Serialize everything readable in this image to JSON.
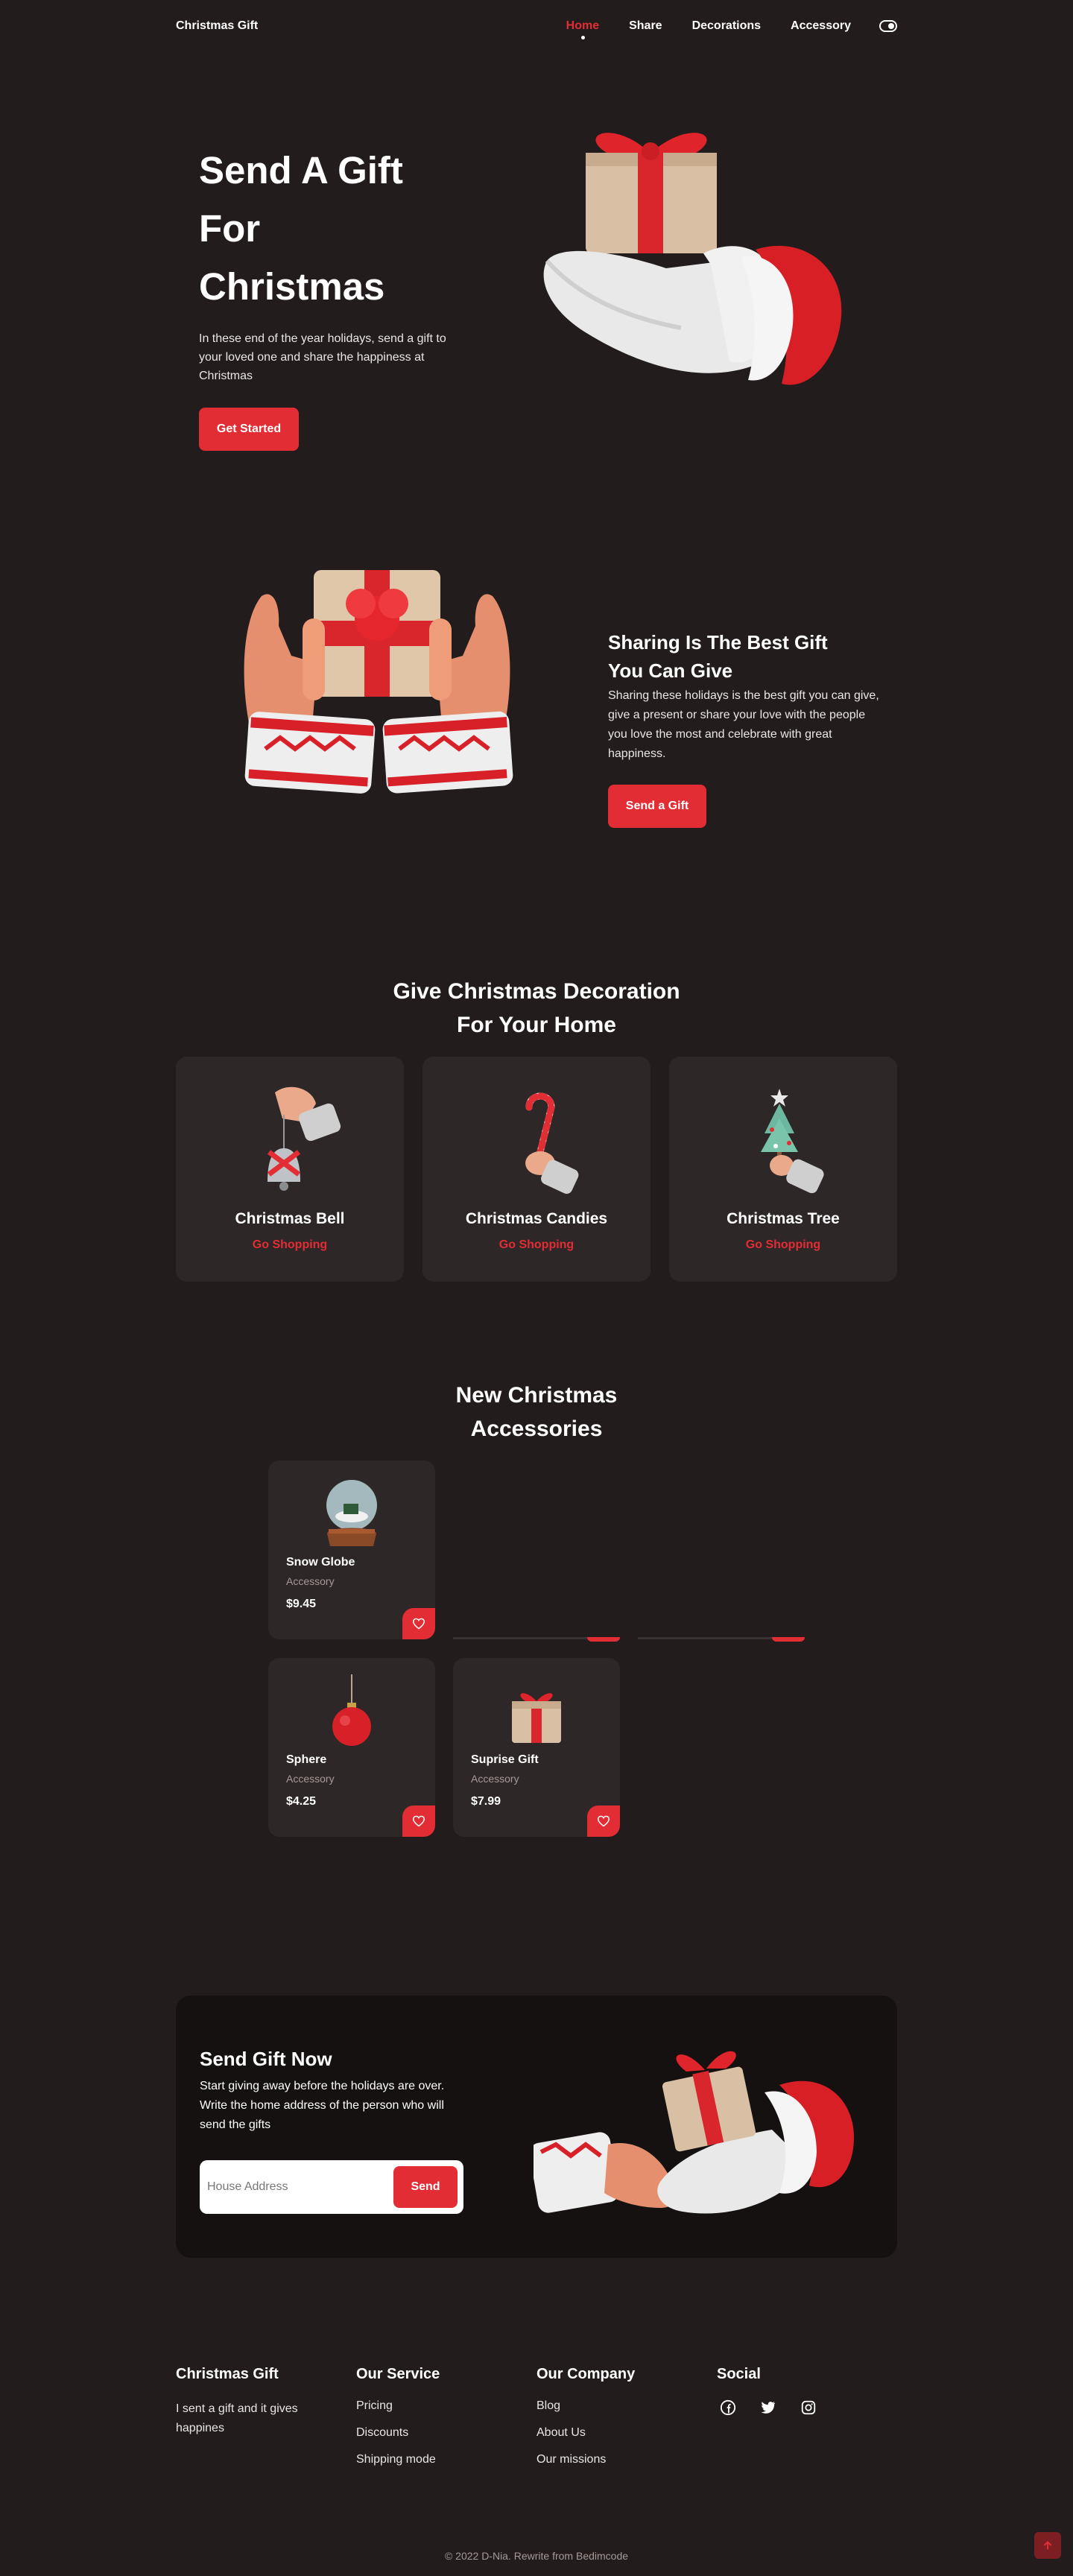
{
  "nav": {
    "logo": "Christmas Gift",
    "links": [
      "Home",
      "Share",
      "Decorations",
      "Accessory"
    ]
  },
  "hero": {
    "title_line1": "Send A Gift For",
    "title_line2": "Christmas",
    "description": "In these end of the year holidays, send a gift to your loved one and share the happiness at Christmas",
    "cta": "Get Started"
  },
  "share": {
    "title_line1": "Sharing Is The Best Gift",
    "title_line2": "You Can Give",
    "description": "Sharing these holidays is the best gift you can give, give a present or share your love with the people you love the most and celebrate with great happiness.",
    "cta": "Send a Gift"
  },
  "decorations": {
    "title_line1": "Give Christmas Decoration",
    "title_line2": "For Your Home",
    "items": [
      {
        "name": "Christmas Bell",
        "link": "Go Shopping"
      },
      {
        "name": "Christmas Candies",
        "link": "Go Shopping"
      },
      {
        "name": "Christmas Tree",
        "link": "Go Shopping"
      }
    ]
  },
  "accessories": {
    "title_line1": "New Christmas",
    "title_line2": "Accessories",
    "items": [
      {
        "name": "Snow Globe",
        "category": "Accessory",
        "price": "$9.45"
      },
      {
        "name": "Sphere",
        "category": "Accessory",
        "price": "$4.25"
      },
      {
        "name": "Suprise Gift",
        "category": "Accessory",
        "price": "$7.99"
      }
    ]
  },
  "send": {
    "title": "Send Gift Now",
    "description": "Start giving away before the holidays are over. Write the home address of the person who will send the gifts",
    "placeholder": "House Address",
    "button": "Send"
  },
  "footer": {
    "brand": {
      "title": "Christmas Gift",
      "text": "I sent a gift and it gives happines"
    },
    "service": {
      "title": "Our Service",
      "links": [
        "Pricing",
        "Discounts",
        "Shipping mode"
      ]
    },
    "company": {
      "title": "Our Company",
      "links": [
        "Blog",
        "About Us",
        "Our missions"
      ]
    },
    "social": {
      "title": "Social",
      "icons": [
        "facebook-icon",
        "twitter-icon",
        "instagram-icon"
      ]
    },
    "copyright": "© 2022 D-Nia. Rewrite from Bedimcode"
  },
  "colors": {
    "accent": "#e32d35",
    "background": "#221d1c",
    "card": "#2e2727",
    "dark_box": "#141110"
  }
}
